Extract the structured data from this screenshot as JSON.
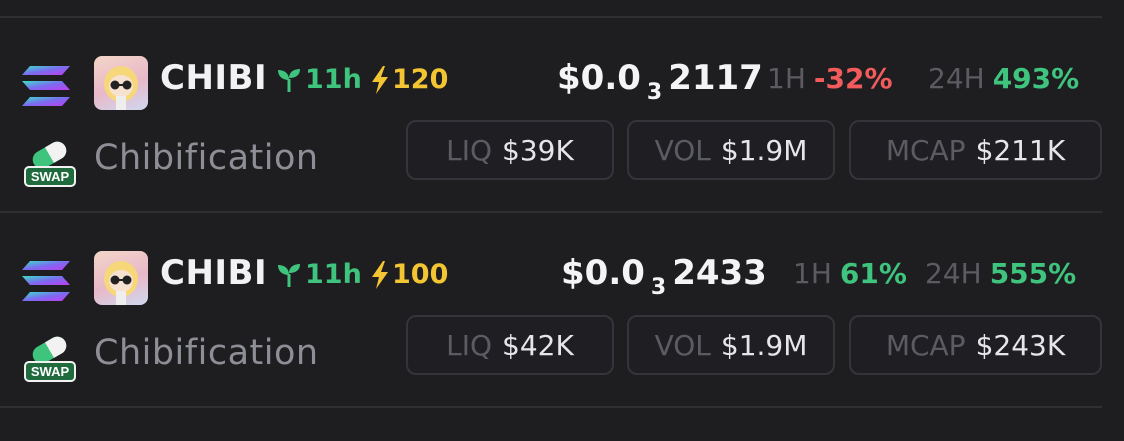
{
  "colors": {
    "background": "#1e1e21",
    "positive": "#3fc47e",
    "negative": "#f25c5c",
    "boost": "#f4c533",
    "muted": "#5b5b62"
  },
  "icons": {
    "chain": "solana-logo-icon",
    "swap": "swap-platform-icon",
    "age": "seedling-icon",
    "boost": "lightning-bolt-icon"
  },
  "tokens": [
    {
      "ticker": "CHIBI",
      "name": "Chibification",
      "age": "11h",
      "boost": "120",
      "price_prefix": "$0.0",
      "price_zeros": "3",
      "price_digits": "2117",
      "h1_label": "1H",
      "h1_value": "-32%",
      "h24_label": "24H",
      "h24_value": "493%",
      "swap_label": "SWAP",
      "liq_label": "LIQ",
      "liq_value": "$39K",
      "vol_label": "VOL",
      "vol_value": "$1.9M",
      "mcap_label": "MCAP",
      "mcap_value": "$211K"
    },
    {
      "ticker": "CHIBI",
      "name": "Chibification",
      "age": "11h",
      "boost": "100",
      "price_prefix": "$0.0",
      "price_zeros": "3",
      "price_digits": "2433",
      "h1_label": "1H",
      "h1_value": "61%",
      "h24_label": "24H",
      "h24_value": "555%",
      "swap_label": "SWAP",
      "liq_label": "LIQ",
      "liq_value": "$42K",
      "vol_label": "VOL",
      "vol_value": "$1.9M",
      "mcap_label": "MCAP",
      "mcap_value": "$243K"
    }
  ]
}
